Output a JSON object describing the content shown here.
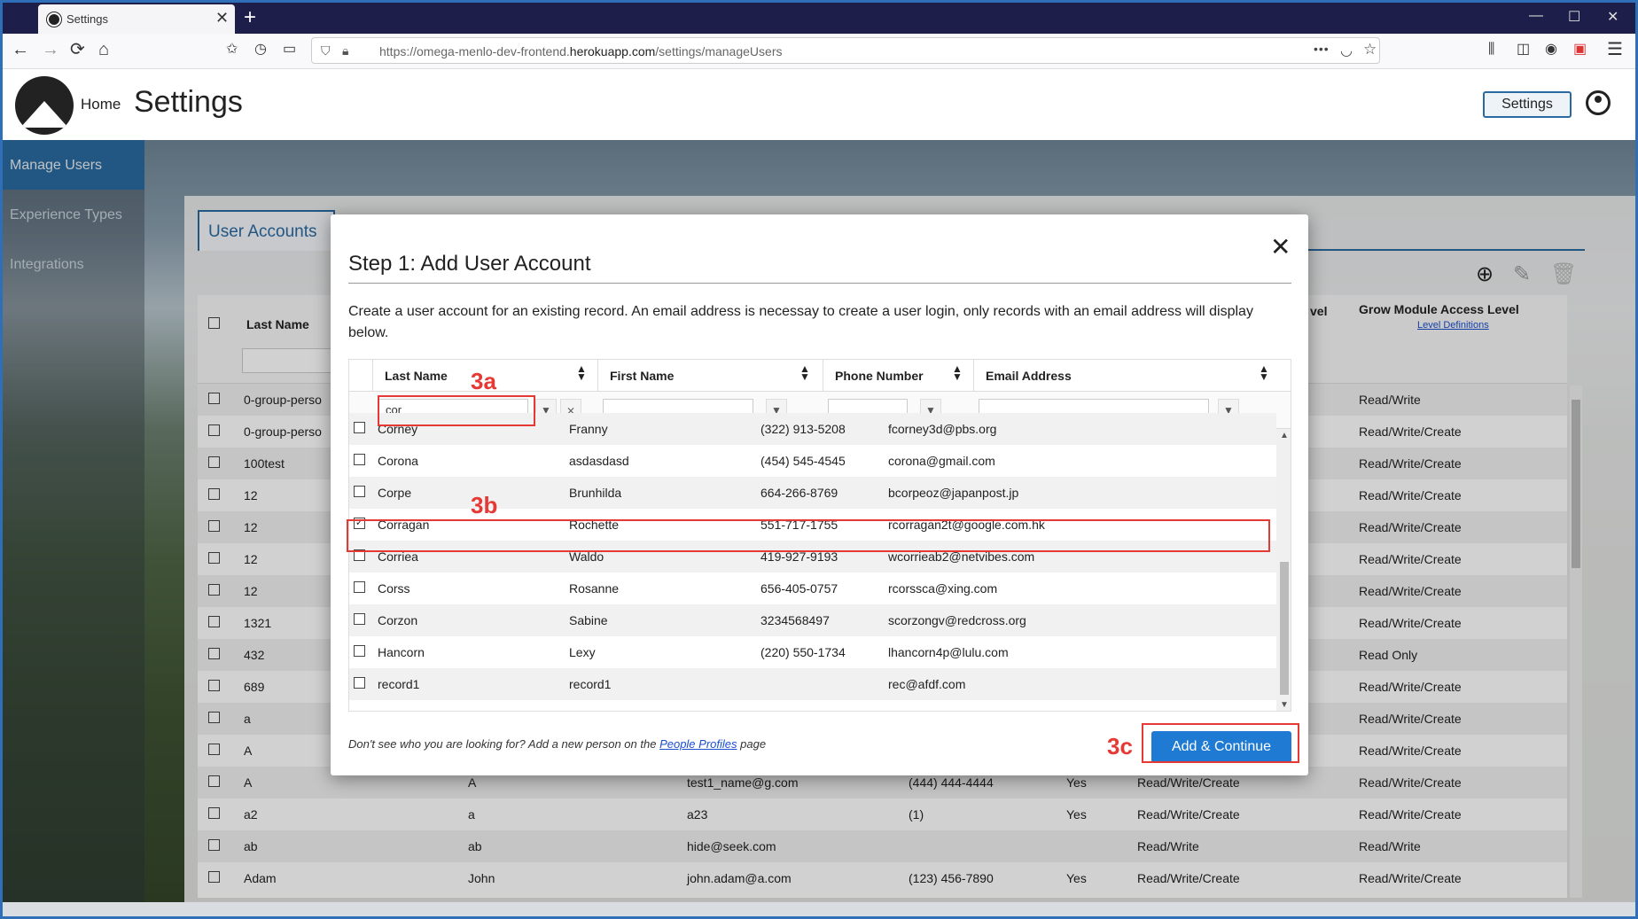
{
  "browser": {
    "tab_title": "Settings",
    "tab_close": "✕",
    "new_tab": "+",
    "url_prefix": "https://omega-menlo-dev-frontend.",
    "url_host": "herokuapp.com",
    "url_path": "/settings/manageUsers",
    "icons": {
      "back": "←",
      "forward": "→",
      "reload": "⟳",
      "home": "⌂",
      "minimize": "—",
      "maximize": "☐",
      "close": "✕",
      "more": "•••",
      "menu": "☰"
    }
  },
  "header": {
    "home_label": "Home",
    "title": "Settings",
    "settings_button": "Settings"
  },
  "sidebar": {
    "items": [
      {
        "label": "Manage Users",
        "active": true
      },
      {
        "label": "Experience Types",
        "active": false
      },
      {
        "label": "Integrations",
        "active": false
      }
    ]
  },
  "background_table": {
    "tab_label": "User Accounts",
    "headers": {
      "last_name": "Last Name",
      "access_level_fragment": "vel",
      "grow_module": "Grow Module Access Level",
      "level_definitions": "Level Definitions"
    },
    "rows": [
      {
        "last": "0-group-perso",
        "first": "",
        "email": "",
        "phone": "",
        "yes": "",
        "access": "",
        "grow": "Read/Write"
      },
      {
        "last": "0-group-perso",
        "first": "",
        "email": "",
        "phone": "",
        "yes": "",
        "access": "",
        "grow": "Read/Write/Create"
      },
      {
        "last": "100test",
        "first": "",
        "email": "",
        "phone": "",
        "yes": "",
        "access": "",
        "grow": "Read/Write/Create"
      },
      {
        "last": "12",
        "first": "",
        "email": "",
        "phone": "",
        "yes": "",
        "access": "",
        "grow": "Read/Write/Create"
      },
      {
        "last": "12",
        "first": "",
        "email": "",
        "phone": "",
        "yes": "",
        "access": "",
        "grow": "Read/Write/Create"
      },
      {
        "last": "12",
        "first": "",
        "email": "",
        "phone": "",
        "yes": "",
        "access": "",
        "grow": "Read/Write/Create"
      },
      {
        "last": "12",
        "first": "",
        "email": "",
        "phone": "",
        "yes": "",
        "access": "",
        "grow": "Read/Write/Create"
      },
      {
        "last": "1321",
        "first": "",
        "email": "",
        "phone": "",
        "yes": "",
        "access": "",
        "grow": "Read/Write/Create"
      },
      {
        "last": "432",
        "first": "",
        "email": "",
        "phone": "",
        "yes": "",
        "access": "",
        "grow": "Read Only"
      },
      {
        "last": "689",
        "first": "",
        "email": "",
        "phone": "",
        "yes": "",
        "access": "",
        "grow": "Read/Write/Create"
      },
      {
        "last": "a",
        "first": "",
        "email": "",
        "phone": "",
        "yes": "",
        "access": "",
        "grow": "Read/Write/Create"
      },
      {
        "last": "A",
        "first": "",
        "email": "",
        "phone": "",
        "yes": "",
        "access": "",
        "grow": "Read/Write/Create"
      },
      {
        "last": "A",
        "first": "A",
        "email": "test1_name@g.com",
        "phone": "(444) 444-4444",
        "yes": "Yes",
        "access": "Read/Write/Create",
        "grow": "Read/Write/Create"
      },
      {
        "last": "a2",
        "first": "a",
        "email": "a23",
        "phone": "(1)",
        "yes": "Yes",
        "access": "Read/Write/Create",
        "grow": "Read/Write/Create"
      },
      {
        "last": "ab",
        "first": "ab",
        "email": "hide@seek.com",
        "phone": "",
        "yes": "",
        "access": "Read/Write",
        "grow": "Read/Write"
      },
      {
        "last": "Adam",
        "first": "John",
        "email": "john.adam@a.com",
        "phone": "(123) 456-7890",
        "yes": "Yes",
        "access": "Read/Write/Create",
        "grow": "Read/Write/Create"
      }
    ]
  },
  "modal": {
    "title": "Step 1: Add User Account",
    "close": "✕",
    "description": "Create a user account for an existing record. An email address is necessay to create a user login, only records with an email address will display below.",
    "columns": [
      "Last Name",
      "First Name",
      "Phone Number",
      "Email Address"
    ],
    "filter_last_name": "cor",
    "rows": [
      {
        "last": "Corney",
        "first": "Franny",
        "phone": "(322) 913-5208",
        "email": "fcorney3d@pbs.org",
        "checked": false
      },
      {
        "last": "Corona",
        "first": "asdasdasd",
        "phone": "(454) 545-4545",
        "email": "corona@gmail.com",
        "checked": false
      },
      {
        "last": "Corpe",
        "first": "Brunhilda",
        "phone": "664-266-8769",
        "email": "bcorpeoz@japanpost.jp",
        "checked": false
      },
      {
        "last": "Corragan",
        "first": "Rochette",
        "phone": "551-717-1755",
        "email": "rcorragan2t@google.com.hk",
        "checked": true
      },
      {
        "last": "Corriea",
        "first": "Waldo",
        "phone": "419-927-9193",
        "email": "wcorrieab2@netvibes.com",
        "checked": false
      },
      {
        "last": "Corss",
        "first": "Rosanne",
        "phone": "656-405-0757",
        "email": "rcorssca@xing.com",
        "checked": false
      },
      {
        "last": "Corzon",
        "first": "Sabine",
        "phone": "3234568497",
        "email": "scorzongv@redcross.org",
        "checked": false
      },
      {
        "last": "Hancorn",
        "first": "Lexy",
        "phone": "(220) 550-1734",
        "email": "lhancorn4p@lulu.com",
        "checked": false
      },
      {
        "last": "record1",
        "first": "record1",
        "phone": "",
        "email": "rec@afdf.com",
        "checked": false
      }
    ],
    "hint_before": "Don't see who you are looking for? Add a new person on the ",
    "hint_link": "People Profiles",
    "hint_after": " page",
    "add_button": "Add & Continue"
  },
  "annotations": {
    "a": "3a",
    "b": "3b",
    "c": "3c"
  },
  "colors": {
    "accent": "#2a6aa0",
    "button": "#1f7ad4",
    "annotation": "#e53935",
    "tabbar": "#1e1e4a"
  }
}
